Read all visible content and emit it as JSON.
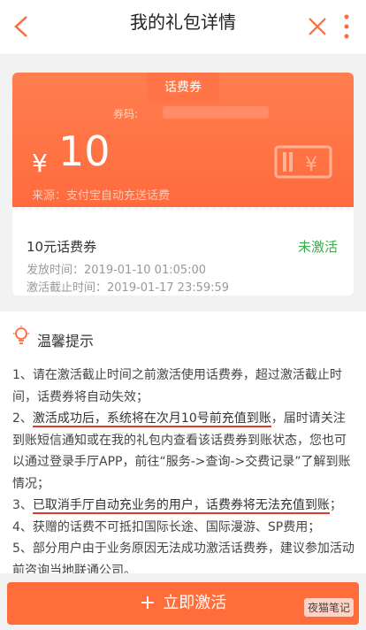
{
  "header": {
    "title": "我的礼包详情",
    "back_icon": "chevron-left-icon",
    "close_icon": "close-icon",
    "more_icon": "more-vertical-icon",
    "accent": "#ff6a3d"
  },
  "ticket": {
    "tab_label": "话费券",
    "code_label": "券码:",
    "currency": "¥",
    "amount": "10",
    "source": "来源：支付宝自动充送话费"
  },
  "card": {
    "name": "10元话费券",
    "status": "未激活",
    "issue_time": "发放时间：2019-01-10 01:05:00",
    "deadline": "激活截止时间：2019-01-17 23:59:59"
  },
  "tips": {
    "title": "温馨提示",
    "items": [
      "1、请在激活截止时间之前激活使用话费券，超过激活截止时间，话费券将自动失效；",
      "2、",
      "激活成功后，系统将在次月10号前充值到账",
      "，届时请关注到账短信通知或在我的礼包内查看该话费券到账状态，您也可以通过登录手厅APP，前往“服务->查询->交费记录”了解到账情况；",
      "3、",
      "已取消手厅自动充业务的用户，话费券将无法充值到账",
      "；",
      "4、获赠的话费不可抵扣国际长途、国际漫游、SP费用；",
      "5、部分用户由于业务原因无法成功激活话费券，建议参加活动前咨询当地联通公司。"
    ]
  },
  "footer": {
    "plus": "+",
    "activate_label": "立即激活",
    "watermark": "夜猫笔记"
  }
}
